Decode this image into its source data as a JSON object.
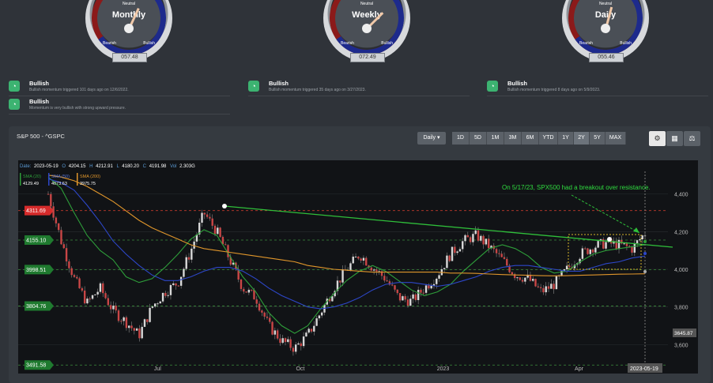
{
  "gauges": [
    {
      "title": "Monthly",
      "neutral": "Neutral",
      "bearish": "Bearish",
      "bullish": "Bullish",
      "value": "057.48",
      "angle": 25
    },
    {
      "title": "Weekly",
      "neutral": "Neutral",
      "bearish": "Bearish",
      "bullish": "Bullish",
      "value": "072.49",
      "angle": 45
    },
    {
      "title": "Daily",
      "neutral": "Neutral",
      "bearish": "Bearish",
      "bullish": "Bullish",
      "value": "055.46",
      "angle": 15
    }
  ],
  "signals": [
    {
      "title": "Bullish",
      "text": "Bullish momentum triggered 101 days ago on 12/6/2022."
    },
    {
      "title": "Bullish",
      "text": "Momentum is very bullish with strong upward pressure."
    },
    {
      "title": "Bullish",
      "text": "Bullish momentum triggered 35 days ago on 3/27/2023."
    },
    {
      "title": "Bullish",
      "text": "Bullish momentum triggered 8 days ago on 5/9/2023."
    }
  ],
  "panel": {
    "symbol": "S&P 500 - ^GSPC",
    "interval": "Daily ▾"
  },
  "ranges": [
    "1D",
    "5D",
    "1M",
    "3M",
    "6M",
    "YTD",
    "1Y",
    "2Y",
    "5Y",
    "MAX"
  ],
  "active_range": "2Y",
  "icons": {
    "settings": "settings-icon",
    "calculator": "calculator-icon",
    "scale": "scale-icon"
  },
  "ohlc": {
    "date_label": "Date:",
    "date": "2023-05-19",
    "o_label": "O",
    "o": "4204.15",
    "h_label": "H",
    "h": "4212.91",
    "l_label": "L",
    "l": "4180.20",
    "c_label": "C",
    "c": "4191.98",
    "vol_label": "Vol",
    "vol": "2.303G"
  },
  "legend": [
    {
      "name": "SMA (20)",
      "value": "4129.49",
      "color": "#2e9e3a"
    },
    {
      "name": "SMA (50)",
      "value": "4073.63",
      "color": "#2d47c9"
    },
    {
      "name": "SMA (200)",
      "value": "3975.75",
      "color": "#e0962b"
    }
  ],
  "annotation": "On 5/17/23, SPX500 had a breakout over resistance.",
  "price_levels": [
    {
      "label": "4311.69",
      "value": 4311.69,
      "color": "#d62b2b",
      "line": "#c0392b"
    },
    {
      "label": "4155.10",
      "value": 4155.1,
      "color": "#1f7a2f",
      "line": "#3c8f3c"
    },
    {
      "label": "3998.51",
      "value": 3998.51,
      "color": "#1f7a2f",
      "line": "#3c8f3c"
    },
    {
      "label": "3804.76",
      "value": 3804.76,
      "color": "#1f7a2f",
      "line": "#3c8f3c"
    },
    {
      "label": "3491.58",
      "value": 3491.58,
      "color": "#1f7a2f",
      "line": "#3c8f3c"
    }
  ],
  "marker_label": "3645.87",
  "date_marker": "2023-05-19",
  "chart_data": {
    "type": "line",
    "ylim": [
      3480,
      4520
    ],
    "y_ticks": [
      4400,
      4200,
      4000,
      3800,
      3600
    ],
    "y_tick_labels": [
      "4,400",
      "4,200",
      "4,000",
      "3,800",
      "3,600"
    ],
    "x_tick_labels": [
      "Jul",
      "Oct",
      "2023",
      "Apr"
    ],
    "x_tick_positions": [
      0.205,
      0.415,
      0.625,
      0.825
    ],
    "series": [
      {
        "name": "SMA (20)",
        "color": "#2e9e3a",
        "values": [
          4490,
          4430,
          4300,
          4180,
          4100,
          4050,
          3960,
          3930,
          3950,
          4010,
          4080,
          4160,
          4210,
          4180,
          4070,
          3960,
          3880,
          3770,
          3700,
          3660,
          3700,
          3790,
          3870,
          3940,
          3990,
          4020,
          3990,
          3940,
          3890,
          3860,
          3880,
          3920,
          3990,
          4050,
          4110,
          4130,
          4110,
          4070,
          4010,
          3980,
          3990,
          4040,
          4080,
          4100,
          4110,
          4120,
          4130
        ]
      },
      {
        "name": "SMA (50)",
        "color": "#2d47c9",
        "values": [
          4480,
          4460,
          4420,
          4340,
          4250,
          4150,
          4080,
          4020,
          3970,
          3940,
          3940,
          3960,
          3990,
          4010,
          4010,
          3990,
          3950,
          3900,
          3860,
          3830,
          3800,
          3790,
          3800,
          3820,
          3850,
          3890,
          3920,
          3930,
          3930,
          3920,
          3910,
          3920,
          3940,
          3960,
          3990,
          4010,
          4020,
          4020,
          4010,
          4000,
          3990,
          3990,
          4010,
          4030,
          4040,
          4060,
          4070
        ]
      },
      {
        "name": "SMA (200)",
        "color": "#e0962b",
        "values": [
          4500,
          4490,
          4470,
          4440,
          4400,
          4360,
          4310,
          4260,
          4220,
          4190,
          4160,
          4130,
          4110,
          4100,
          4090,
          4080,
          4070,
          4060,
          4050,
          4040,
          4020,
          4010,
          4000,
          3995,
          3990,
          3985,
          3985,
          3985,
          3985,
          3985,
          3985,
          3980,
          3980,
          3978,
          3975,
          3972,
          3970,
          3968,
          3966,
          3965,
          3966,
          3968,
          3970,
          3972,
          3974,
          3975,
          3976
        ]
      },
      {
        "name": "Close",
        "color": "#cfcfcf",
        "values": [
          4400,
          4150,
          3950,
          3820,
          3900,
          3780,
          3720,
          3650,
          3800,
          3880,
          3930,
          4100,
          4300,
          4200,
          4050,
          3900,
          3850,
          3700,
          3620,
          3580,
          3650,
          3770,
          3900,
          4000,
          4080,
          4010,
          3950,
          3850,
          3830,
          3900,
          3970,
          4080,
          4150,
          4180,
          4120,
          4050,
          3970,
          3950,
          3880,
          3920,
          4000,
          4080,
          4120,
          4140,
          4130,
          4110,
          4192
        ]
      }
    ]
  }
}
